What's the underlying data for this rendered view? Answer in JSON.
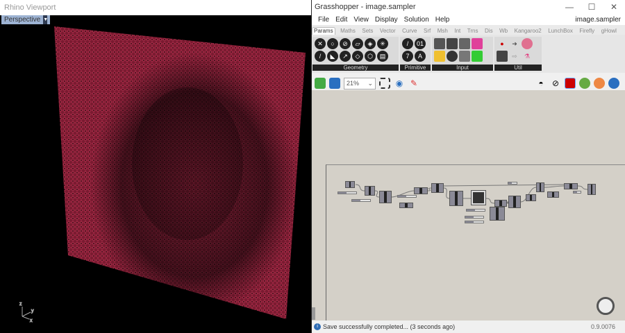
{
  "rhino": {
    "title": "Rhino Viewport",
    "view": "Perspective",
    "axis": {
      "z": "z",
      "y": "y",
      "x": "x"
    }
  },
  "gh": {
    "title": "Grasshopper - image.sampler",
    "window_controls": [
      "—",
      "☐",
      "✕"
    ],
    "menu": [
      "File",
      "Edit",
      "View",
      "Display",
      "Solution",
      "Help"
    ],
    "doc_name": "image.sampler",
    "tabs": [
      "Params",
      "Maths",
      "Sets",
      "Vector",
      "Curve",
      "Srf",
      "Msh",
      "Int",
      "Trns",
      "Dis",
      "Wb",
      "Kangaroo2",
      "LunchBox",
      "Firefly",
      "gHowl"
    ],
    "active_tab": "Params",
    "groups": [
      "Geometry",
      "Primitive",
      "Input",
      "Util"
    ],
    "primitive_icons": [
      "/",
      "01",
      "7",
      "A"
    ],
    "zoom": "21%",
    "status": "Save successfully completed... (3 seconds ago)",
    "version": "0.9.0076",
    "colors": {
      "lattice": "#8a1c35",
      "canvas": "#d4d0c8",
      "node": "#8b8a97"
    }
  }
}
